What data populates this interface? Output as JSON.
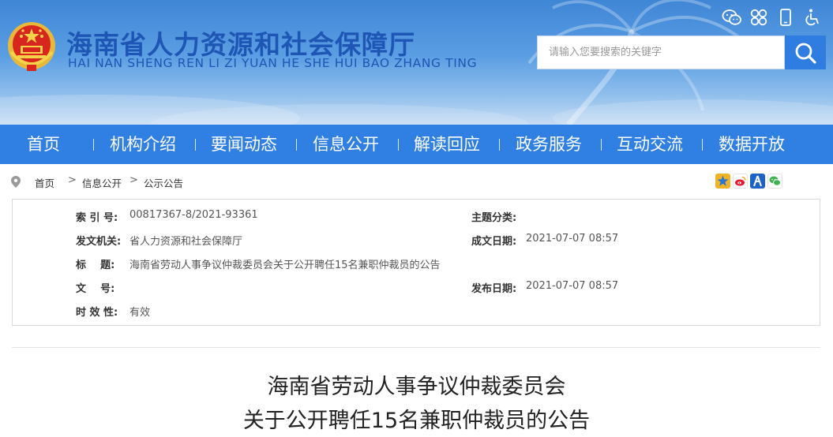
{
  "header": {
    "title": "海南省人力资源和社会保障厅",
    "subtitle": "HAI NAN SHENG REN LI ZI YUAN HE SHE HUI BAO ZHANG TING",
    "search": {
      "placeholder": "请输入您要搜索的关键字"
    },
    "top_icons": [
      "wechat-icon",
      "app-grid-icon",
      "mobile-icon",
      "accessibility-icon"
    ]
  },
  "nav": {
    "items": [
      "首页",
      "机构介绍",
      "要闻动态",
      "信息公开",
      "解读回应",
      "政务服务",
      "互动交流",
      "数据开放"
    ]
  },
  "breadcrumb": {
    "items": [
      "首页",
      "信息公开",
      "公示公告"
    ],
    "separator": ">"
  },
  "share_icons": [
    "qzone-icon",
    "weibo-icon",
    "renren-icon",
    "wechat-share-icon"
  ],
  "meta": {
    "index_label": "索 引 号:",
    "index_value": "00817367-8/2021-93361",
    "topic_label": "主题分类:",
    "topic_value": "",
    "issuer_label": "发文机关:",
    "issuer_value": "省人力资源和社会保障厅",
    "created_label": "成文日期:",
    "created_value": "2021-07-07 08:57",
    "title_label": "标    题:",
    "title_value": "海南省劳动人事争议仲裁委员会关于公开聘任15名兼职仲裁员的公告",
    "docno_label": "文    号:",
    "docno_value": "",
    "published_label": "发布日期:",
    "published_value": "2021-07-07 08:57",
    "validity_label": "时 效 性:",
    "validity_value": "有效"
  },
  "article": {
    "title_line1": "海南省劳动人事争议仲裁委员会",
    "title_line2": "关于公开聘任15名兼职仲裁员的公告"
  },
  "colors": {
    "nav_bg": "#2f80e2",
    "title_blue": "#1d56b4",
    "search_button": "#2f7de0"
  }
}
